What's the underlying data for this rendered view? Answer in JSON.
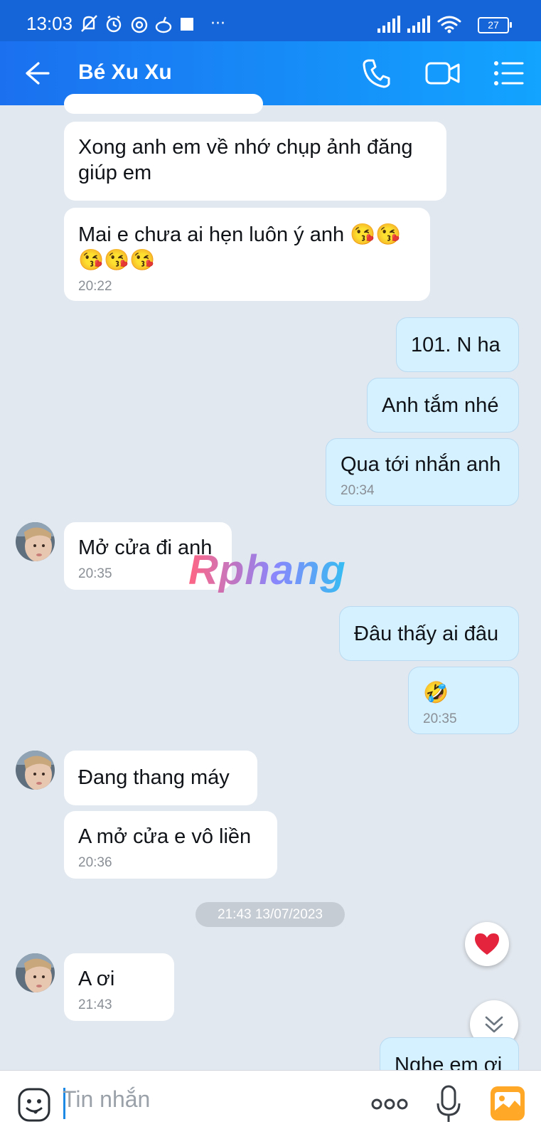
{
  "status_bar": {
    "time": "13:03",
    "battery": "27",
    "more": "···"
  },
  "header": {
    "contact_name": "Bé Xu Xu"
  },
  "messages": [
    {
      "text": "Xong anh em về nhớ chụp ảnh đăng giúp em",
      "direction": "in"
    },
    {
      "text": "Mai e chưa ai hẹn luôn ý anh 😘😘😘😘😘",
      "time": "20:22",
      "direction": "in"
    },
    {
      "text": "101. N ha",
      "direction": "out"
    },
    {
      "text": "Anh tắm nhé",
      "direction": "out"
    },
    {
      "text": "Qua tới nhắn anh",
      "time": "20:34",
      "direction": "out"
    },
    {
      "text": "Mở cửa đi anh",
      "time": "20:35",
      "direction": "in"
    },
    {
      "text": "Đâu thấy ai đâu",
      "direction": "out"
    },
    {
      "text": "🤣",
      "time": "20:35",
      "direction": "out"
    },
    {
      "text": "Đang thang máy",
      "direction": "in"
    },
    {
      "text": "A mở cửa e vô liền",
      "time": "20:36",
      "direction": "in"
    },
    {
      "text": "A ơi",
      "time": "21:43",
      "direction": "in"
    },
    {
      "text": "Nghe em ơi",
      "direction": "out"
    }
  ],
  "date_separator": "21:43 13/07/2023",
  "watermark": "Rphang",
  "composer": {
    "placeholder": "Tin nhắn"
  },
  "colors": {
    "header_start": "#1b70ef",
    "header_end": "#12a4ff",
    "outgoing_bubble": "#d5f0ff",
    "incoming_bubble": "#ffffff",
    "background": "#e2e8ef"
  }
}
